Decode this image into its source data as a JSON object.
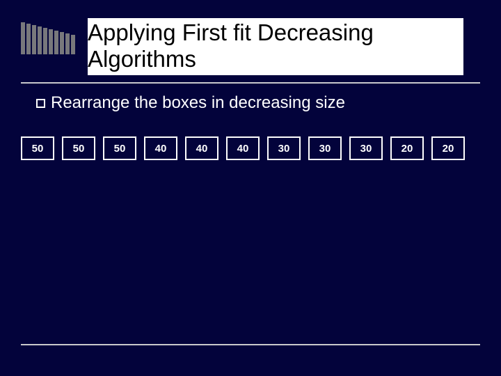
{
  "title": {
    "line1": "Applying First fit Decreasing",
    "line2": "Algorithms"
  },
  "bullet": {
    "text": "Rearrange the boxes in decreasing size"
  },
  "boxes": [
    "50",
    "50",
    "50",
    "40",
    "40",
    "40",
    "30",
    "30",
    "30",
    "20",
    "20"
  ],
  "bars_heights": [
    46,
    44,
    42,
    40,
    38,
    36,
    34,
    32,
    30,
    28
  ]
}
